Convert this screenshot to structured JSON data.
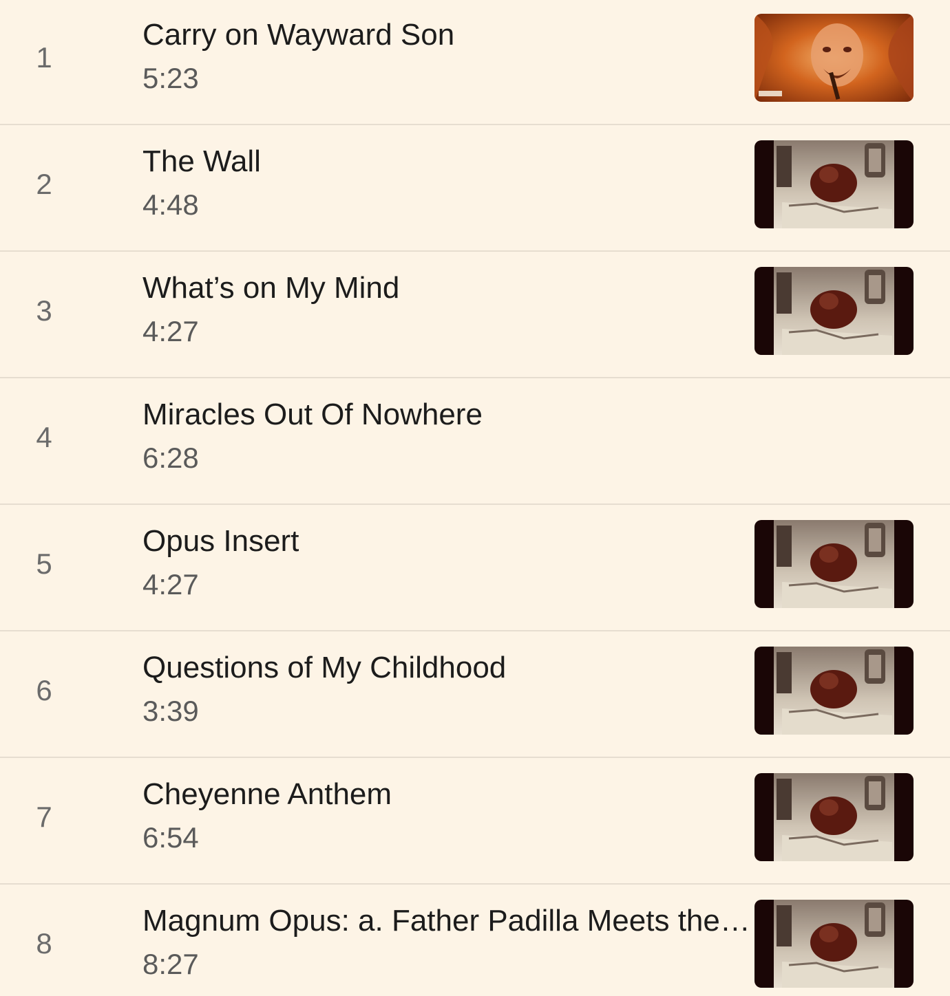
{
  "colors": {
    "background": "#fdf4e6",
    "divider": "#e6ddd0",
    "title": "#1c1c1c",
    "duration": "#5a5a5a",
    "number": "#6b6b6b"
  },
  "tracks": [
    {
      "number": "1",
      "title": "Carry on Wayward Son",
      "duration": "5:23",
      "thumbnail": "concert-singer"
    },
    {
      "number": "2",
      "title": "The Wall",
      "duration": "4:48",
      "thumbnail": "album-art"
    },
    {
      "number": "3",
      "title": "What’s on My Mind",
      "duration": "4:27",
      "thumbnail": "album-art"
    },
    {
      "number": "4",
      "title": "Miracles Out Of Nowhere",
      "duration": "6:28",
      "thumbnail": "none"
    },
    {
      "number": "5",
      "title": "Opus Insert",
      "duration": "4:27",
      "thumbnail": "album-art"
    },
    {
      "number": "6",
      "title": "Questions of My Childhood",
      "duration": "3:39",
      "thumbnail": "album-art"
    },
    {
      "number": "7",
      "title": "Cheyenne Anthem",
      "duration": "6:54",
      "thumbnail": "album-art"
    },
    {
      "number": "8",
      "title": "Magnum Opus: a. Father Padilla Meets the Perfect Gnat",
      "duration": "8:27",
      "thumbnail": "album-art"
    }
  ]
}
